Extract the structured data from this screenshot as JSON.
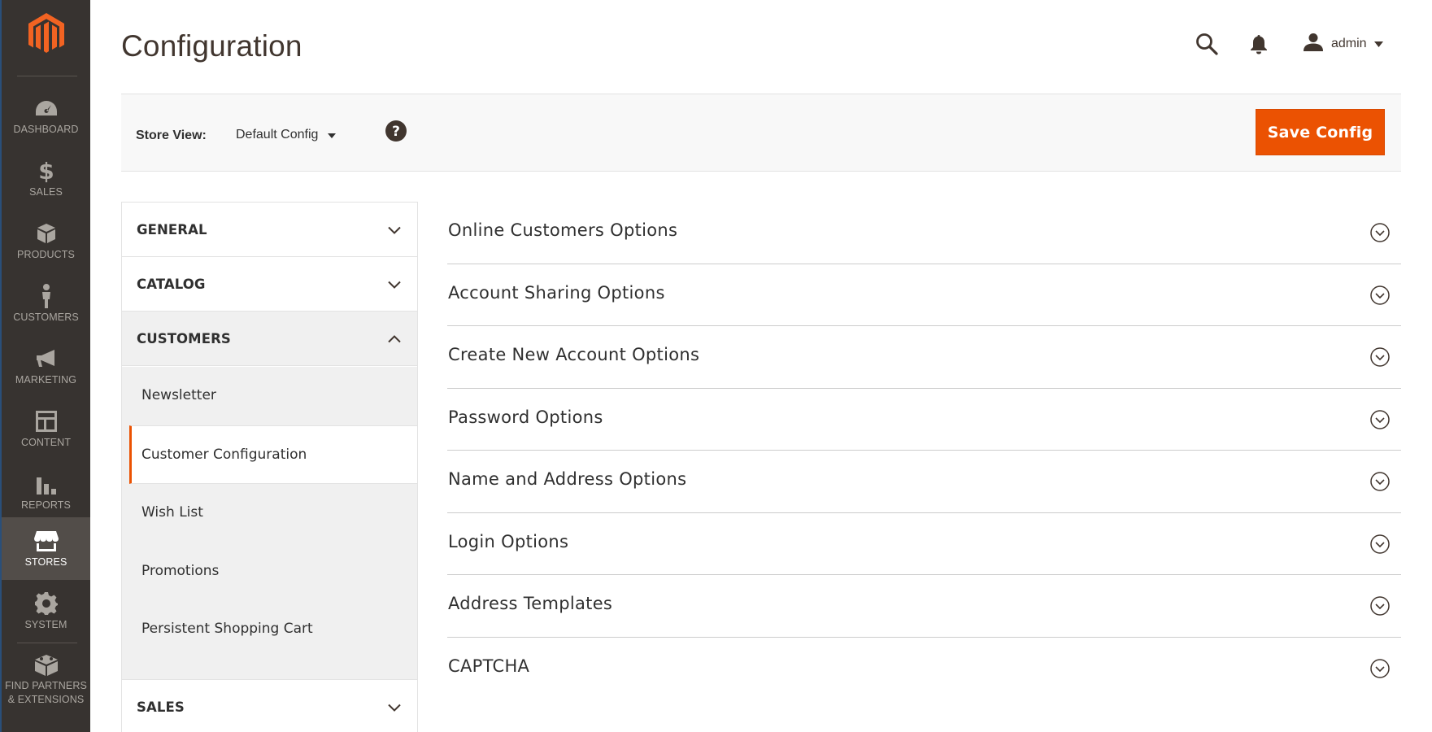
{
  "colors": {
    "menu_bg": "#373330",
    "accent": "#eb5202",
    "active_menu_bg": "#524d49"
  },
  "menu": {
    "items": [
      {
        "label": "DASHBOARD",
        "icon": "dashboard-icon"
      },
      {
        "label": "SALES",
        "icon": "dollar-icon"
      },
      {
        "label": "PRODUCTS",
        "icon": "box-icon"
      },
      {
        "label": "CUSTOMERS",
        "icon": "person-icon"
      },
      {
        "label": "MARKETING",
        "icon": "megaphone-icon"
      },
      {
        "label": "CONTENT",
        "icon": "layout-icon"
      },
      {
        "label": "REPORTS",
        "icon": "bar-chart-icon"
      },
      {
        "label": "STORES",
        "icon": "storefront-icon",
        "active": true
      },
      {
        "label": "SYSTEM",
        "icon": "gear-icon"
      },
      {
        "label": "FIND PARTNERS & EXTENSIONS",
        "icon": "blocks-icon"
      }
    ]
  },
  "header": {
    "title": "Configuration",
    "user_name": "admin"
  },
  "store_bar": {
    "label": "Store View:",
    "selected": "Default Config",
    "save_label": "Save Config"
  },
  "tabs": [
    {
      "label": "GENERAL",
      "open": false
    },
    {
      "label": "CATALOG",
      "open": false
    },
    {
      "label": "CUSTOMERS",
      "open": true
    },
    {
      "label": "SALES",
      "open": false
    }
  ],
  "customers_items": [
    {
      "label": "Newsletter"
    },
    {
      "label": "Customer Configuration",
      "active": true
    },
    {
      "label": "Wish List"
    },
    {
      "label": "Promotions"
    },
    {
      "label": "Persistent Shopping Cart"
    }
  ],
  "sections": [
    {
      "title": "Online Customers Options"
    },
    {
      "title": "Account Sharing Options"
    },
    {
      "title": "Create New Account Options"
    },
    {
      "title": "Password Options"
    },
    {
      "title": "Name and Address Options"
    },
    {
      "title": "Login Options"
    },
    {
      "title": "Address Templates"
    },
    {
      "title": "CAPTCHA"
    }
  ]
}
